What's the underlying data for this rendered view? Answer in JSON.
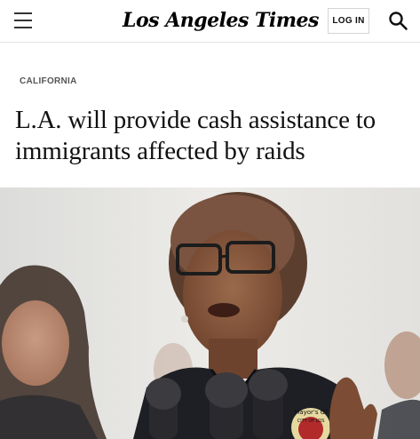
{
  "header": {
    "logo_text": "Los Angeles Times",
    "login_label": "LOG IN",
    "menu_icon": "hamburger-menu-icon",
    "search_icon": "search-icon"
  },
  "article": {
    "section": "CALIFORNIA",
    "headline": "L.A. will provide cash assistance to immigrants affected by raids"
  },
  "photo": {
    "badge_text": "Mayor's Of",
    "badge_text_2": "CITY OF LOS"
  },
  "colors": {
    "text": "#111111",
    "section": "#555555",
    "border": "#e2e2e2",
    "jacket": "#1d1f25",
    "skin": "#8a5a3f"
  }
}
